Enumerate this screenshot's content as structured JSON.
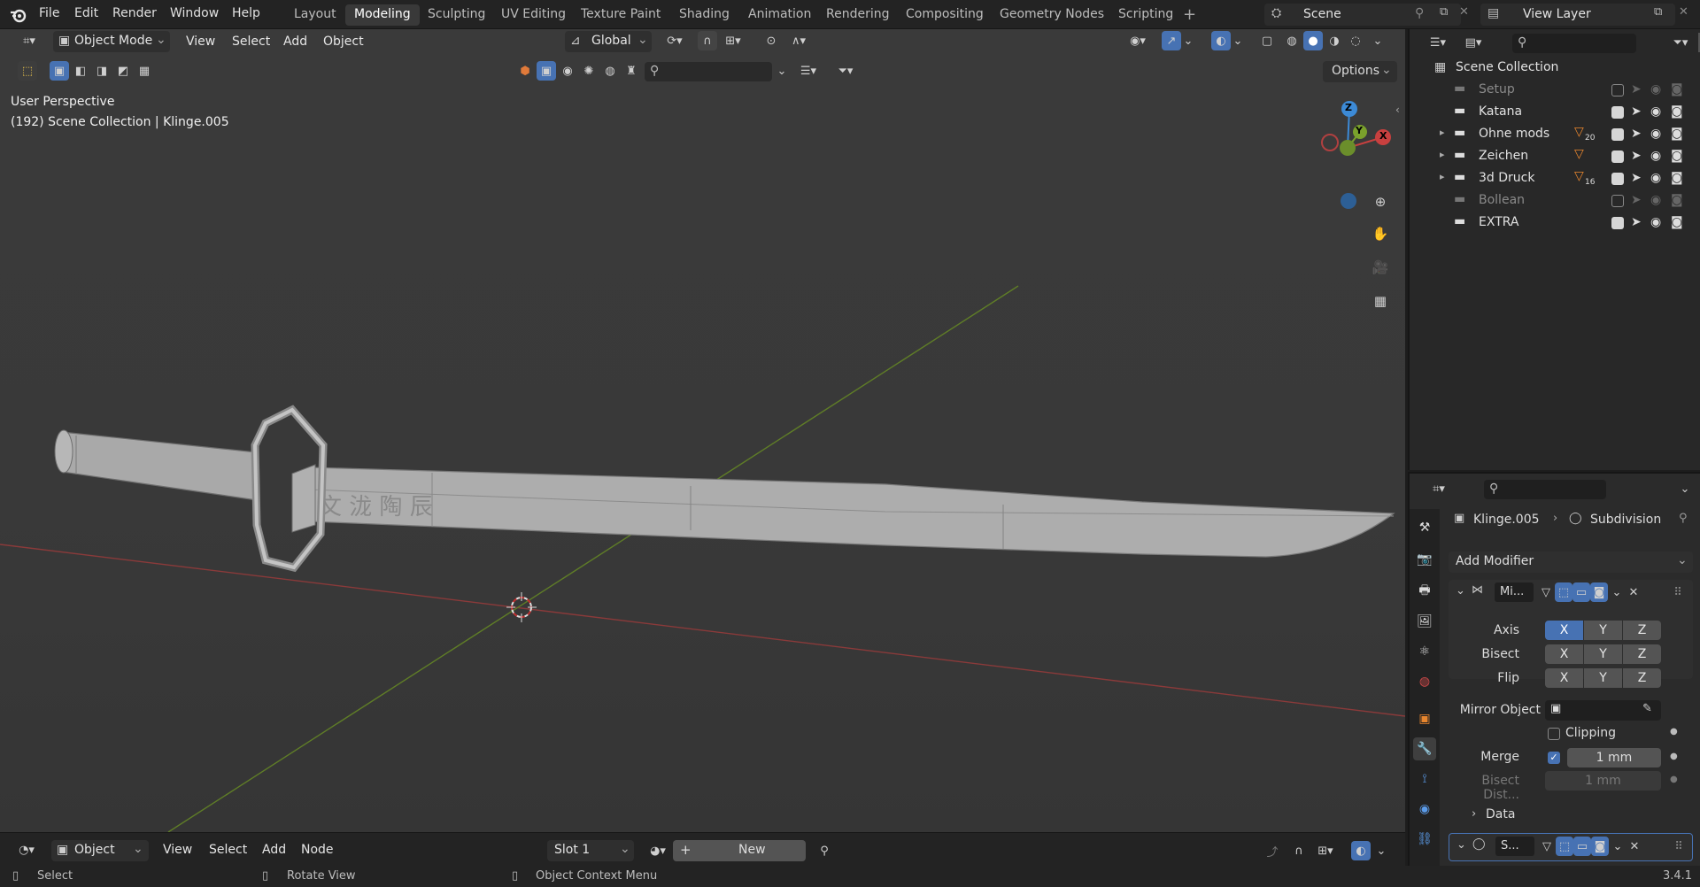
{
  "topbar": {
    "menus": [
      "File",
      "Edit",
      "Render",
      "Window",
      "Help"
    ],
    "workspaces": [
      "Layout",
      "Modeling",
      "Sculpting",
      "UV Editing",
      "Texture Paint",
      "Shading",
      "Animation",
      "Rendering",
      "Compositing",
      "Geometry Nodes",
      "Scripting"
    ],
    "active_workspace": "Modeling",
    "scene": "Scene",
    "view_layer": "View Layer"
  },
  "viewport": {
    "mode": "Object Mode",
    "menus": [
      "View",
      "Select",
      "Add",
      "Object"
    ],
    "transform_orientation": "Global",
    "options_label": "Options",
    "info_line1": "User Perspective",
    "info_line2": "(192) Scene Collection | Klinge.005",
    "gizmo": {
      "z": "Z",
      "y": "Y",
      "x": "X"
    },
    "colors": {
      "x_axis": "#c8403f",
      "y_axis": "#7aa12c",
      "z_axis": "#3c8ad6"
    }
  },
  "outliner": {
    "root": "Scene Collection",
    "items": [
      {
        "label": "Setup",
        "visible": false,
        "expandable": false,
        "badge": ""
      },
      {
        "label": "Katana",
        "visible": true,
        "expandable": false,
        "badge": ""
      },
      {
        "label": "Ohne mods",
        "visible": true,
        "expandable": true,
        "badge": "20"
      },
      {
        "label": "Zeichen",
        "visible": true,
        "expandable": true,
        "badge": ""
      },
      {
        "label": "3d Druck",
        "visible": true,
        "expandable": true,
        "badge": "16"
      },
      {
        "label": "Bollean",
        "visible": false,
        "expandable": false,
        "badge": ""
      },
      {
        "label": "EXTRA",
        "visible": true,
        "expandable": false,
        "badge": ""
      }
    ]
  },
  "properties": {
    "object": "Klinge.005",
    "modifier_context": "Subdivision",
    "add_modifier": "Add Modifier",
    "mirror": {
      "name": "Mi...",
      "axis_label": "Axis",
      "bisect_label": "Bisect",
      "flip_label": "Flip",
      "x": "X",
      "y": "Y",
      "z": "Z",
      "mirror_object_label": "Mirror Object",
      "clipping_label": "Clipping",
      "merge_label": "Merge",
      "merge_value": "1 mm",
      "bisect_dist_label": "Bisect Dist...",
      "bisect_dist_value": "1 mm",
      "data_label": "Data"
    },
    "second_modifier_name": "S..."
  },
  "bottom_header": {
    "mode": "Object",
    "menus": [
      "View",
      "Select",
      "Add",
      "Node"
    ],
    "slot": "Slot 1",
    "new_label": "New"
  },
  "statusbar": {
    "select": "Select",
    "rotate": "Rotate View",
    "context": "Object Context Menu",
    "version": "3.4.1"
  }
}
